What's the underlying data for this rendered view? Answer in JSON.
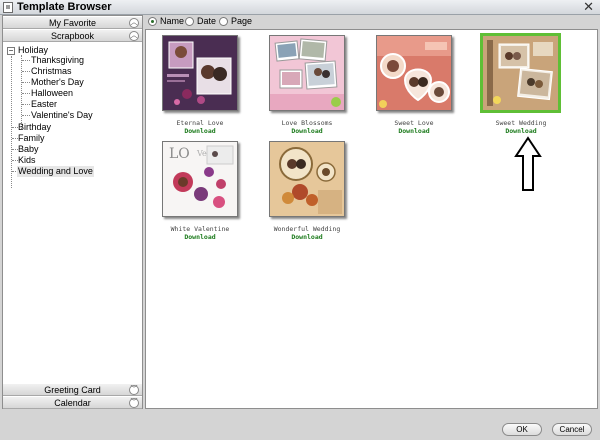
{
  "window": {
    "title": "Template Browser",
    "close_glyph": "✕"
  },
  "left_panel": {
    "headers": {
      "my_favorite": "My Favorite",
      "scrapbook": "Scrapbook",
      "greeting_card": "Greeting Card",
      "calendar": "Calendar"
    },
    "tree": {
      "holiday": {
        "label": "Holiday",
        "toggle": "−",
        "children": [
          "Thanksgiving",
          "Christmas",
          "Mother's Day",
          "Halloween",
          "Easter",
          "Valentine's Day"
        ]
      },
      "others": [
        "Birthday",
        "Family",
        "Baby",
        "Kids",
        "Wedding and Love"
      ],
      "selected": "Wedding and Love"
    }
  },
  "sort": {
    "options": [
      "Name",
      "Date",
      "Page"
    ],
    "selected": "Name"
  },
  "templates": [
    {
      "name": "Eternal Love",
      "action": "Download",
      "selected": false
    },
    {
      "name": "Love Blossoms",
      "action": "Download",
      "selected": false
    },
    {
      "name": "Sweet Love",
      "action": "Download",
      "selected": false
    },
    {
      "name": "Sweet Wedding",
      "action": "Download",
      "selected": true
    },
    {
      "name": "White Valentine",
      "action": "Download",
      "selected": false
    },
    {
      "name": "Wonderful Wedding",
      "action": "Download",
      "selected": false
    }
  ],
  "footer": {
    "ok_label": "OK",
    "cancel_label": "Cancel"
  },
  "icons": [
    "window-icon",
    "close-icon",
    "chevron-up-icon",
    "chevron-down-icon",
    "collapse-icon",
    "arrow-up-icon"
  ],
  "colors": {
    "selection_border": "#5fbf36",
    "download_text": "#1b7a1b"
  }
}
